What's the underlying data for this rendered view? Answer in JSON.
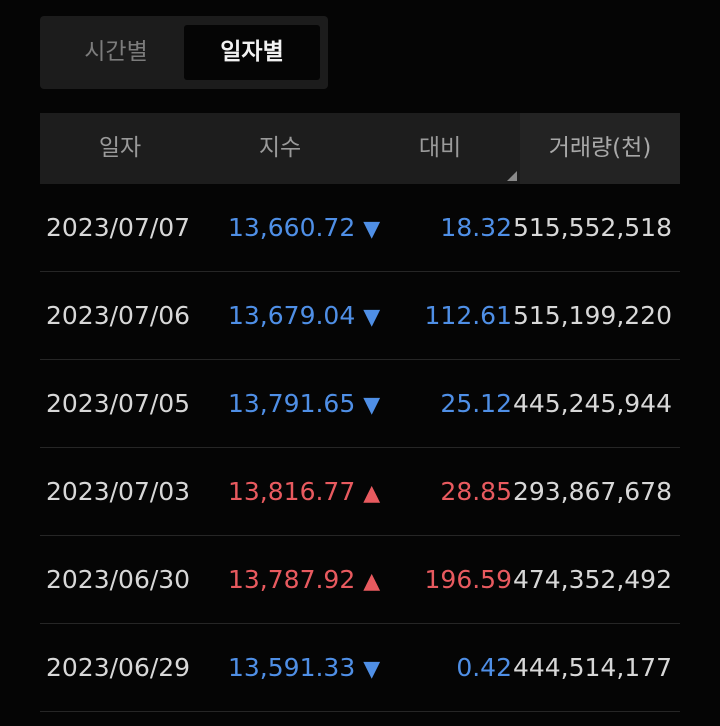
{
  "tabs": [
    {
      "label": "시간별",
      "active": false
    },
    {
      "label": "일자별",
      "active": true
    }
  ],
  "table": {
    "headers": {
      "date": "일자",
      "index": "지수",
      "change": "대비",
      "volume": "거래량(천)"
    },
    "rows": [
      {
        "date": "2023/07/07",
        "index": "13,660.72",
        "arrow": "▼",
        "direction": "down",
        "change": "18.32",
        "volume": "515,552,518"
      },
      {
        "date": "2023/07/06",
        "index": "13,679.04",
        "arrow": "▼",
        "direction": "down",
        "change": "112.61",
        "volume": "515,199,220"
      },
      {
        "date": "2023/07/05",
        "index": "13,791.65",
        "arrow": "▼",
        "direction": "down",
        "change": "25.12",
        "volume": "445,245,944"
      },
      {
        "date": "2023/07/03",
        "index": "13,816.77",
        "arrow": "▲",
        "direction": "up",
        "change": "28.85",
        "volume": "293,867,678"
      },
      {
        "date": "2023/06/30",
        "index": "13,787.92",
        "arrow": "▲",
        "direction": "up",
        "change": "196.59",
        "volume": "474,352,492"
      },
      {
        "date": "2023/06/29",
        "index": "13,591.33",
        "arrow": "▼",
        "direction": "down",
        "change": "0.42",
        "volume": "444,514,177"
      }
    ]
  },
  "colors": {
    "down": "#4f8fe6",
    "up": "#e85a5f",
    "background": "#050505"
  }
}
